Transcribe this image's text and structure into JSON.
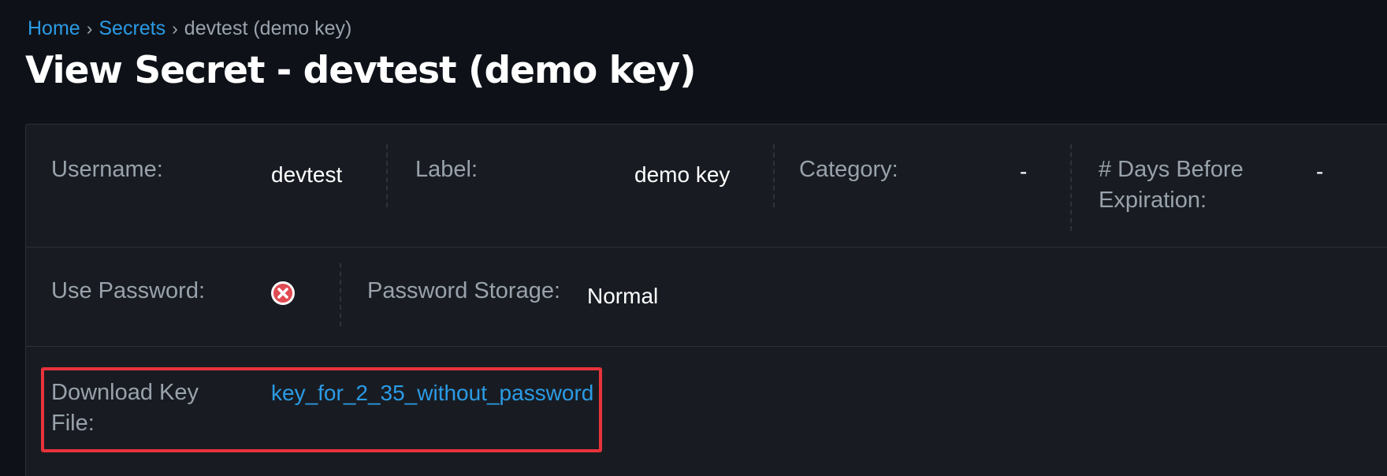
{
  "breadcrumb": {
    "home": "Home",
    "secrets": "Secrets",
    "current": "devtest (demo key)",
    "separator": "›"
  },
  "page_title": "View Secret - devtest (demo key)",
  "details": {
    "username_label": "Username:",
    "username_value": "devtest",
    "label_label": "Label:",
    "label_value": "demo key",
    "category_label": "Category:",
    "category_value": "-",
    "days_label": "# Days Before Expiration:",
    "days_value": "-",
    "use_password_label": "Use Password:",
    "use_password_icon": "x-circle-icon",
    "password_storage_label": "Password Storage:",
    "password_storage_value": "Normal",
    "download_label": "Download Key File:",
    "download_link": "key_for_2_35_without_password"
  },
  "colors": {
    "link": "#2b9be6",
    "highlight": "#e8323c",
    "error_icon": "#e04b53"
  }
}
